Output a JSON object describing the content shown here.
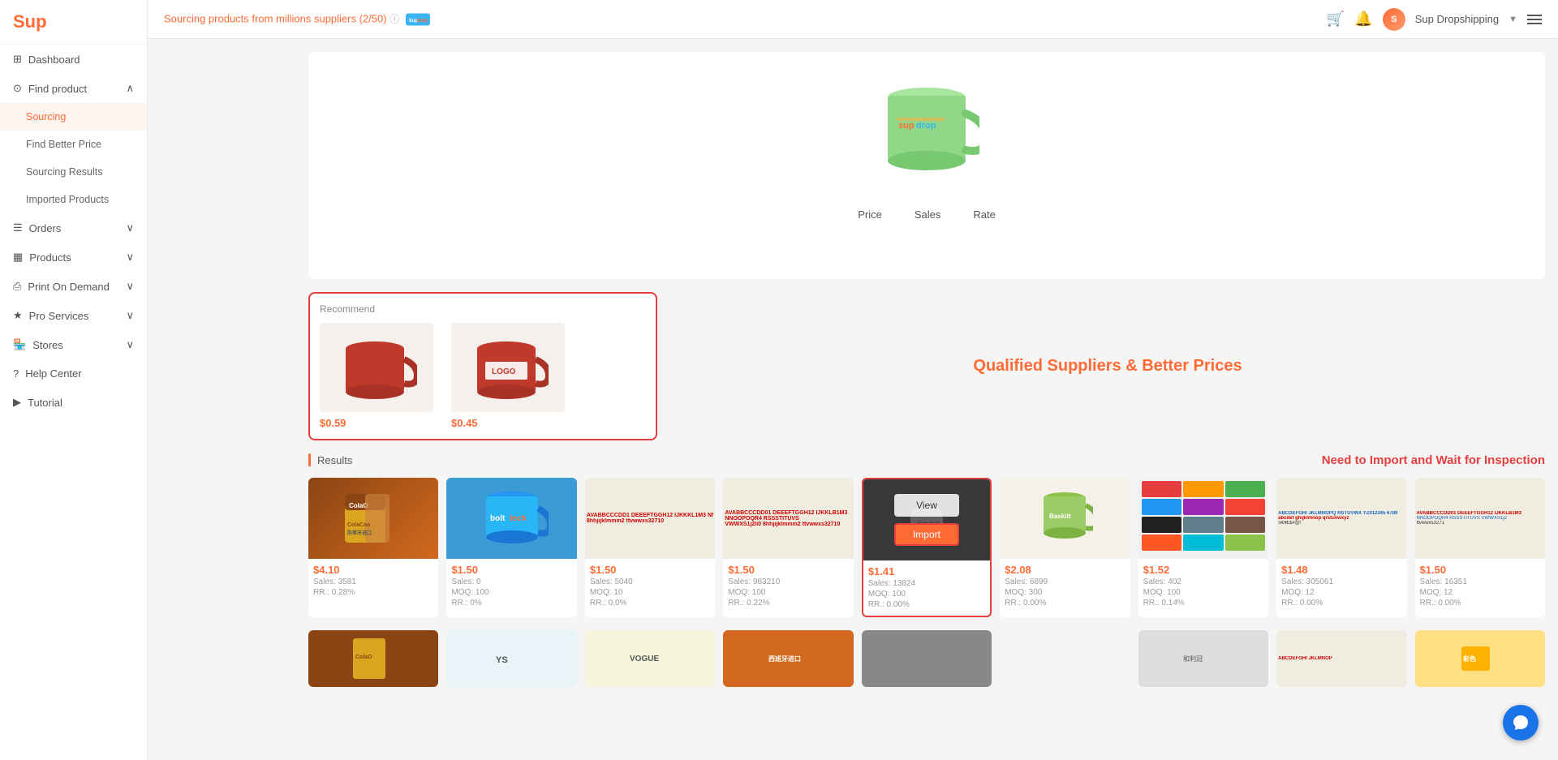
{
  "app": {
    "name": "Sup",
    "logo_color": "#ff6b35"
  },
  "header": {
    "sourcing_info": "Sourcing products from millions suppliers (2/50)",
    "username": "Sup Dropshipping",
    "cart_icon": "cart-icon",
    "bell_icon": "bell-icon",
    "menu_icon": "menu-icon"
  },
  "sidebar": {
    "logo": "Sup",
    "items": [
      {
        "id": "dashboard",
        "label": "Dashboard",
        "icon": "dashboard-icon",
        "has_arrow": false,
        "active": false
      },
      {
        "id": "find-product",
        "label": "Find product",
        "icon": "search-icon",
        "has_arrow": true,
        "active": false
      },
      {
        "id": "sourcing",
        "label": "Sourcing",
        "icon": "",
        "sub": true,
        "active": true
      },
      {
        "id": "find-better-price",
        "label": "Find Better Price",
        "icon": "",
        "sub": true,
        "active": false
      },
      {
        "id": "sourcing-results",
        "label": "Sourcing Results",
        "icon": "",
        "sub": true,
        "active": false
      },
      {
        "id": "imported-products",
        "label": "Imported Products",
        "icon": "",
        "sub": true,
        "active": false
      },
      {
        "id": "orders",
        "label": "Orders",
        "icon": "orders-icon",
        "has_arrow": true,
        "active": false
      },
      {
        "id": "products",
        "label": "Products",
        "icon": "products-icon",
        "has_arrow": true,
        "active": false
      },
      {
        "id": "print-on-demand",
        "label": "Print On Demand",
        "icon": "print-icon",
        "has_arrow": true,
        "active": false
      },
      {
        "id": "pro-services",
        "label": "Pro Services",
        "icon": "pro-icon",
        "has_arrow": true,
        "active": false
      },
      {
        "id": "stores",
        "label": "Stores",
        "icon": "stores-icon",
        "has_arrow": true,
        "active": false
      },
      {
        "id": "help-center",
        "label": "Help Center",
        "icon": "help-icon",
        "has_arrow": false,
        "active": false
      },
      {
        "id": "tutorial",
        "label": "Tutorial",
        "icon": "tutorial-icon",
        "has_arrow": false,
        "active": false
      }
    ]
  },
  "main": {
    "recommend_label": "Recommend",
    "qualified_text": "Qualified Suppliers & Better Prices",
    "results_label": "Results",
    "import_banner_title": "Need to Import and Wait for Inspection",
    "sort_tabs": [
      "Price",
      "Sales",
      "Rate"
    ],
    "recommend_products": [
      {
        "price": "$0.59"
      },
      {
        "price": "$0.45"
      }
    ],
    "products_row1": [
      {
        "price": "$4.10",
        "sales": "Sales: 3581",
        "rr": "RR.: 0.28%",
        "moq": "",
        "type": "colacao"
      },
      {
        "price": "$1.50",
        "sales": "Sales: 0",
        "moq": "MOQ: 100",
        "rr": "RR.: 0%",
        "type": "bolttech"
      },
      {
        "price": "$1.50",
        "sales": "Sales: 5040",
        "moq": "MOQ: 10",
        "rr": "RR.: 0.0%",
        "type": "stickers"
      },
      {
        "price": "$1.50",
        "sales": "Sales: 983210",
        "moq": "MOQ: 100",
        "rr": "RR.: 0.22%",
        "type": "stickers2"
      },
      {
        "price": "$1.41",
        "sales": "Sales: 13824",
        "moq": "MOQ: 100",
        "rr": "RR.: 0.00%",
        "type": "unknown",
        "highlighted": true
      },
      {
        "price": "$2.08",
        "sales": "Sales: 6899",
        "moq": "MOQ: 300",
        "rr": "RR.: 0.00%",
        "type": "greenmug"
      },
      {
        "price": "$1.52",
        "sales": "Sales: 402",
        "moq": "MOQ: 100",
        "rr": "RR.: 0.14%",
        "type": "mugsgrid"
      },
      {
        "price": "$1.48",
        "sales": "Sales: 305061",
        "moq": "MOQ: 12",
        "rr": "RR.: 0.00%",
        "type": "stickers3"
      },
      {
        "price": "$1.50",
        "sales": "Sales: 16351",
        "moq": "MOQ: 12",
        "rr": "RR.: 0.00%",
        "type": "stickers4"
      }
    ],
    "products_row2": [
      {
        "price": "",
        "type": "img1"
      },
      {
        "price": "",
        "type": "img2"
      },
      {
        "price": "",
        "type": "img3"
      },
      {
        "price": "",
        "type": "img4"
      },
      {
        "price": "",
        "type": "img5"
      },
      {
        "price": "",
        "type": "img6"
      },
      {
        "price": "",
        "type": "img7"
      },
      {
        "price": "",
        "type": "img8"
      },
      {
        "price": "",
        "type": "img9"
      }
    ],
    "view_label": "View",
    "import_label": "Import"
  }
}
